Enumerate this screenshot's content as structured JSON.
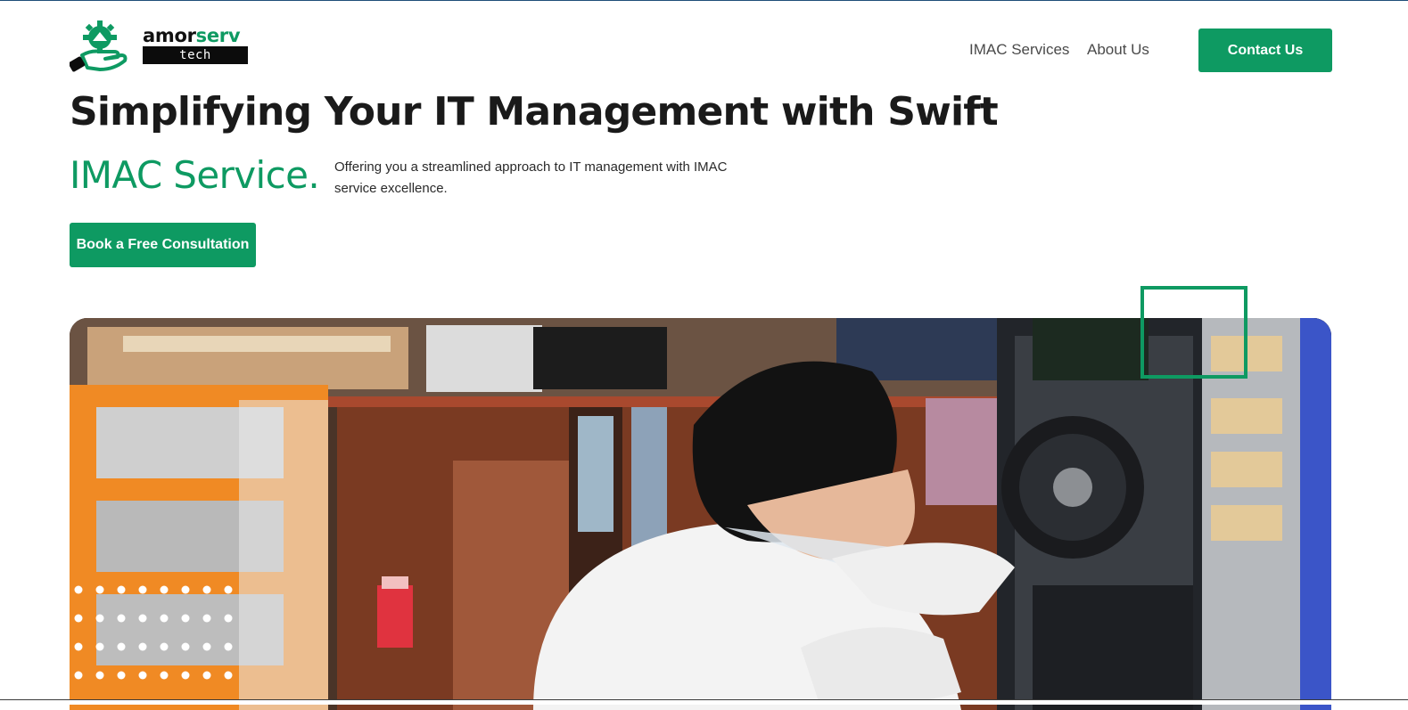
{
  "brand": {
    "name_part1": "amor",
    "name_part2": "serv",
    "tagline": "tech",
    "accent_color": "#0e9a62",
    "logo_icon": "gear-hand-icon"
  },
  "nav": {
    "items": [
      {
        "label": "IMAC Services"
      },
      {
        "label": "About Us"
      }
    ],
    "contact_label": "Contact Us"
  },
  "hero": {
    "title": "Simplifying Your IT Management with Swift",
    "accent": "IMAC Service.",
    "description": "Offering you a streamlined approach to IT management with IMAC service excellence.",
    "cta_label": "Book a Free Consultation"
  },
  "image": {
    "subject": "technician-repairing-computer-photo"
  }
}
